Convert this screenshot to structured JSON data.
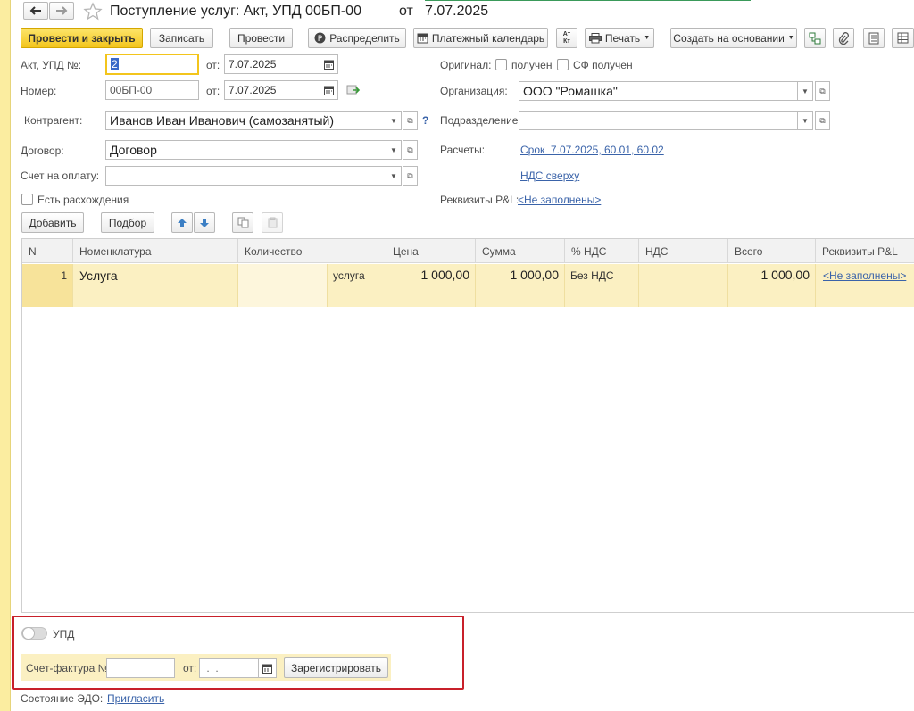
{
  "window": {
    "title": "Поступление услуг: Акт, УПД 00БП-00",
    "title_date_label": "от",
    "title_date": "7.07.2025"
  },
  "toolbar": {
    "post_and_close": "Провести и закрыть",
    "save": "Записать",
    "post": "Провести",
    "distribute": "Распределить",
    "payment_calendar": "Платежный календарь",
    "dt_kt_top": "Ат",
    "dt_kt_bottom": "Кт",
    "print": "Печать",
    "create_based_on": "Создать на основании"
  },
  "header": {
    "act_label": "Акт, УПД №:",
    "act_value": "2",
    "act_date_label": "от:",
    "act_date": "7.07.2025",
    "number_label": "Номер:",
    "number_value": "00БП-00",
    "number_date_label": "от:",
    "number_date": "7.07.2025",
    "contractor_label": "Контрагент:",
    "contractor_value": "Иванов Иван Иванович (самозанятый)",
    "contractor_help": "?",
    "contract_label": "Договор:",
    "contract_value": "Договор",
    "invoice_label": "Счет на оплату:",
    "invoice_value": "",
    "discrepancy_label": "Есть расхождения",
    "original_label": "Оригинал:",
    "original_received": "получен",
    "sf_received": "СФ получен",
    "org_label": "Организация:",
    "org_value": "ООО \"Ромашка\"",
    "division_label": "Подразделение:",
    "division_value": "",
    "settlements_label": "Расчеты:",
    "settlements_link": "Срок  7.07.2025, 60.01, 60.02",
    "vat_link": "НДС сверху",
    "pl_label": "Реквизиты P&L:",
    "pl_link": "<Не заполнены>"
  },
  "table_toolbar": {
    "add": "Добавить",
    "select": "Подбор"
  },
  "table": {
    "columns": [
      "N",
      "Номенклатура",
      "Количество",
      "Цена",
      "Сумма",
      "% НДС",
      "НДС",
      "Всего",
      "Реквизиты P&L"
    ],
    "rows": [
      {
        "n": "1",
        "item": "Услуга",
        "qty": "",
        "unit": "услуга",
        "price": "1 000,00",
        "sum": "1 000,00",
        "vat_rate": "Без НДС",
        "vat": "",
        "total": "1 000,00",
        "pl": "<Не заполнены>"
      }
    ]
  },
  "footer": {
    "upd_label": "УПД",
    "sf_label": "Счет-фактура №:",
    "sf_value": "",
    "sf_date_label": "от:",
    "sf_date": " .  .",
    "register": "Зарегистрировать",
    "edo_label": "Состояние ЭДО:",
    "edo_link": "Пригласить"
  },
  "colors": {
    "primary_button": "#f3c51c",
    "selected_row": "#fbf0c2",
    "link": "#3a63a9",
    "highlight_border": "#c8202a",
    "left_bar": "#fbeda0"
  }
}
